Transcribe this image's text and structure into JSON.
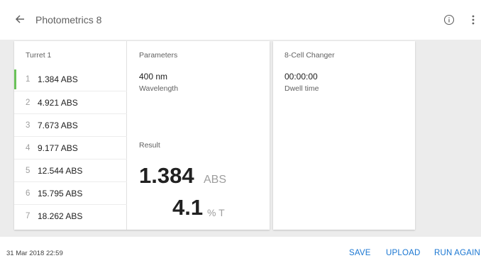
{
  "header": {
    "title": "Photometrics 8",
    "back_icon": "arrow-back-icon",
    "info_icon": "info-icon",
    "menu_icon": "more-vert-icon"
  },
  "turret": {
    "title": "Turret 1",
    "items": [
      {
        "num": "1",
        "value": "1.384 ABS",
        "active": true
      },
      {
        "num": "2",
        "value": "4.921 ABS"
      },
      {
        "num": "3",
        "value": "7.673 ABS"
      },
      {
        "num": "4",
        "value": "9.177 ABS"
      },
      {
        "num": "5",
        "value": "12.544 ABS"
      },
      {
        "num": "6",
        "value": "15.795 ABS"
      },
      {
        "num": "7",
        "value": "18.262 ABS"
      }
    ]
  },
  "parameters": {
    "title": "Parameters",
    "wavelength_value": "400 nm",
    "wavelength_label": "Wavelength"
  },
  "result": {
    "title": "Result",
    "abs_value": "1.384",
    "abs_unit": "ABS",
    "t_value": "4.1",
    "t_unit": "% T"
  },
  "cell_changer": {
    "title": "8-Cell Changer",
    "dwell_value": "00:00:00",
    "dwell_label": "Dwell time"
  },
  "footer": {
    "date": "31 Mar 2018 22:59",
    "save_label": "SAVE",
    "upload_label": "UPLOAD",
    "run_again_label": "RUN AGAIN"
  },
  "colors": {
    "accent_green": "#6ac259",
    "action_blue": "#1976d2"
  }
}
